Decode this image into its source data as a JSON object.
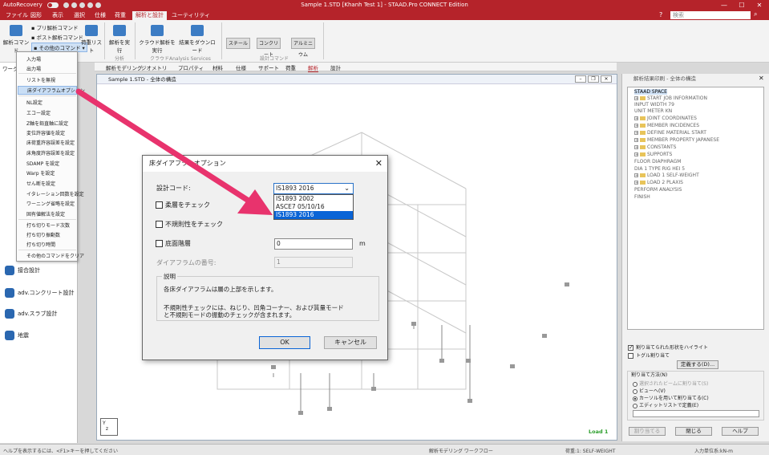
{
  "titlebar": {
    "autorecovery": "AutoRecovery",
    "title": "Sample 1.STD [Khanh Test 1] - STAAD.Pro CONNECT Edition",
    "min": "—",
    "max": "☐",
    "close": "✕"
  },
  "tabs": [
    "ファイル",
    "図形",
    "表示",
    "選択",
    "仕様",
    "荷重",
    "解析と設計",
    "ユーティリティ"
  ],
  "search_placeholder": "検索",
  "ribbon": {
    "analysis_cmd": "解析コマンド",
    "pre_cmd": "プリ解析コマンド",
    "post_cmd": "ポスト解析コマンド",
    "other_cmd": "その他のコマンド",
    "load_list": "荷重リスト",
    "run_analysis": "解析を実行",
    "run_cloud": "クラウド解析を実行",
    "download_results": "結果をダウンロード",
    "steel": "スチール",
    "concrete": "コンクリート",
    "aluminum": "アルミニウム",
    "group_analysis": "分析",
    "group_cloud": "クラウドAnalysis Services",
    "group_design": "設計コマンド"
  },
  "menu": {
    "items": [
      "入力場",
      "出力場",
      "リストを無視",
      "床ダイアフラムオプション",
      "NL設定",
      "エコー設定",
      "Z軸を鉛直軸に設定",
      "変位許容値を設定",
      "床荷重許容誤差を設定",
      "床角度許容誤差を設定",
      "SDAMP を設定",
      "Warp を設定",
      "せん断を設定",
      "イタレーション回数を設定",
      "ワーニング省略を設定",
      "固有値解法を設定",
      "打ち切りモード次数",
      "打ち切り振動数",
      "打ち切り時間",
      "その他のコマンドをクリア"
    ]
  },
  "leftpanel": {
    "header": "ワーク",
    "items": [
      "接合設計",
      "adv.コンクリート設計",
      "adv.スラブ設計",
      "地震"
    ]
  },
  "model_tabs": [
    "解析モデリング",
    "ジオメトリ",
    "プロパティ",
    "材料",
    "仕様",
    "サポート",
    "荷重",
    "解析",
    "設計"
  ],
  "view": {
    "title": "Sample 1.STD - 全体の構造",
    "load_label": "Load 1"
  },
  "rpanel": {
    "title": "解析結果印刷 - 全体の構造",
    "tree": [
      "STAAD SPACE",
      "START JOB INFORMATION",
      "INPUT WIDTH 79",
      "UNIT METER KN",
      "JOINT COORDINATES",
      "MEMBER INCIDENCES",
      "DEFINE MATERIAL START",
      "MEMBER PROPERTY JAPANESE",
      "CONSTANTS",
      "SUPPORTS",
      "FLOOR DIAPHRAGM",
      "DIA 1 TYPE RIG HEI 5",
      "LOAD 1 SELF-WEIGHT",
      "LOAD 2 PLAXIS",
      "PERFORM ANALYSIS",
      "FINISH"
    ],
    "highlight_label": "割り当てられた形状をハイライト",
    "toggle_label": "トグル割り当て",
    "define_btn": "定義する(D)...",
    "assign_method": "割り当て方法(N)",
    "opt_selected": "選択されたビームに割り当て(S)",
    "opt_view": "ビューへ(V)",
    "opt_cursor": "カーソルを用いて割り当てる(C)",
    "opt_edit": "エディットリストで定義(E)",
    "assign_btn": "割り当てる",
    "close_btn": "閉じる",
    "help_btn": "ヘルプ"
  },
  "status": {
    "help": "ヘルプを表示するには、<F1>キーを押してください",
    "workflow": "解析モデリング ワークフロー",
    "load": "荷重:1: SELF-WEIGHT",
    "units": "入力単位系:kN-m"
  },
  "dialog": {
    "title": "床ダイアフラムオプション",
    "close": "✕",
    "design_code_label": "設計コード:",
    "design_code_value": "IS1893 2016",
    "options": [
      "IS1893 2002",
      "ASCE7 05/10/16",
      "IS1893 2016"
    ],
    "soft_story": "柔層をチェック",
    "irregularity": "不規則性をチェック",
    "base_floor": "底面階層",
    "base_floor_value": "0",
    "unit": "m",
    "diaphragm_num_label": "ダイアフラムの番号:",
    "diaphragm_num_value": "1",
    "desc_label": "説明",
    "desc_line1": "各床ダイアフラムは層の上部を示します。",
    "desc_line2": "不規則性チェックには、ねじり、凹角コーナー、および質量モード",
    "desc_line3": "と不規則モードの振動のチェックが含まれます。",
    "ok": "OK",
    "cancel": "キャンセル"
  },
  "colors": {
    "brand": "#b5232a",
    "arrow": "#e8336d",
    "selection": "#0a64d6",
    "load_label": "#2a9d2a"
  }
}
